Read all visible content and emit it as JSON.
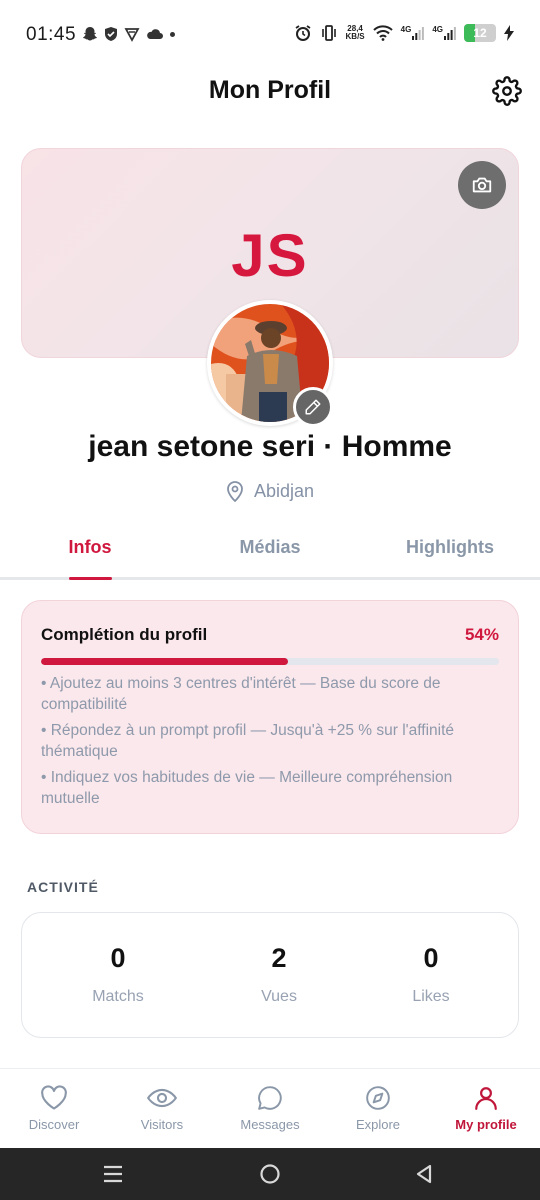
{
  "status_bar": {
    "time": "01:45",
    "net_speed_value": "28,4",
    "net_speed_unit": "KB/S",
    "sim1": "4G",
    "sim2": "4G",
    "battery": "12"
  },
  "header": {
    "title": "Mon Profil"
  },
  "profile": {
    "initials": "JS",
    "name": "jean setone seri · Homme",
    "location": "Abidjan"
  },
  "tabs": [
    {
      "label": "Infos",
      "active": true
    },
    {
      "label": "Médias",
      "active": false
    },
    {
      "label": "Highlights",
      "active": false
    }
  ],
  "completion": {
    "title": "Complétion du profil",
    "percent_label": "54%",
    "percent": 54,
    "tips": [
      "• Ajoutez au moins 3 centres d'intérêt — Base du score de compatibilité",
      "• Répondez à un prompt profil — Jusqu'à +25 % sur l'affinité thématique",
      "• Indiquez vos habitudes de vie — Meilleure compréhension mutuelle"
    ]
  },
  "activity": {
    "label": "ACTIVITÉ",
    "stats": [
      {
        "value": "0",
        "label": "Matchs"
      },
      {
        "value": "2",
        "label": "Vues"
      },
      {
        "value": "0",
        "label": "Likes"
      }
    ]
  },
  "bottom_nav": [
    {
      "label": "Discover",
      "icon": "heart-icon",
      "active": false
    },
    {
      "label": "Visitors",
      "icon": "eye-icon",
      "active": false
    },
    {
      "label": "Messages",
      "icon": "chat-bubble-icon",
      "active": false
    },
    {
      "label": "Explore",
      "icon": "compass-icon",
      "active": false
    },
    {
      "label": "My profile",
      "icon": "user-icon",
      "active": true
    }
  ],
  "colors": {
    "accent": "#d0173e",
    "muted_text": "#8a97a8",
    "card_pink": "#fbe8ec"
  }
}
